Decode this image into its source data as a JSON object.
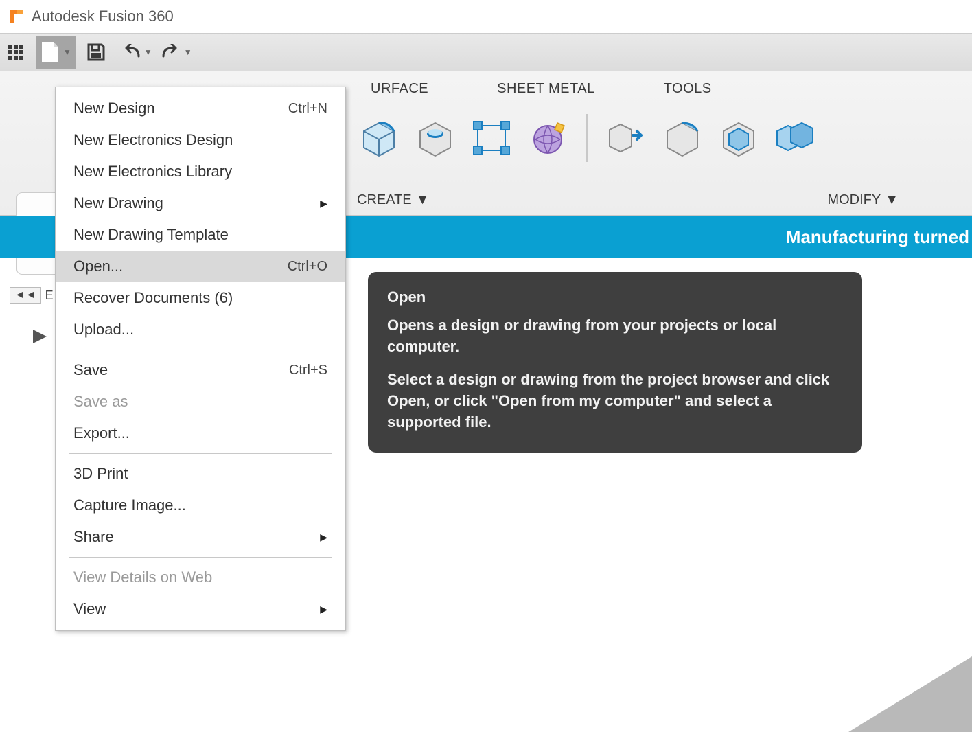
{
  "titlebar": {
    "app_name": "Autodesk Fusion 360"
  },
  "qat": {
    "grid_icon": "grid-icon",
    "file_icon": "file-icon",
    "save_icon": "save-icon",
    "undo_icon": "undo-icon",
    "redo_icon": "redo-icon"
  },
  "ribbon": {
    "tabs": {
      "surface": "URFACE",
      "sheet_metal": "SHEET METAL",
      "tools": "TOOLS"
    },
    "groups": {
      "create": "CREATE",
      "modify": "MODIFY"
    }
  },
  "banner": {
    "text": "Manufacturing turned"
  },
  "nav": {
    "back_label": "◄◄",
    "letter": "E"
  },
  "file_menu": {
    "new_design": {
      "label": "New Design",
      "shortcut": "Ctrl+N"
    },
    "new_elec_design": {
      "label": "New Electronics Design"
    },
    "new_elec_lib": {
      "label": "New Electronics Library"
    },
    "new_drawing": {
      "label": "New Drawing"
    },
    "new_drawing_template": {
      "label": "New Drawing Template"
    },
    "open": {
      "label": "Open...",
      "shortcut": "Ctrl+O"
    },
    "recover": {
      "label": "Recover Documents (6)"
    },
    "upload": {
      "label": "Upload..."
    },
    "save": {
      "label": "Save",
      "shortcut": "Ctrl+S"
    },
    "save_as": {
      "label": "Save as"
    },
    "export": {
      "label": "Export..."
    },
    "print3d": {
      "label": "3D Print"
    },
    "capture": {
      "label": "Capture Image..."
    },
    "share": {
      "label": "Share"
    },
    "view_web": {
      "label": "View Details on Web"
    },
    "view": {
      "label": "View"
    }
  },
  "tooltip": {
    "title": "Open",
    "p1": "Opens a design or drawing from your projects or local computer.",
    "p2": "Select a design or drawing from the project browser and click Open, or click \"Open from my computer\" and select a supported file."
  }
}
